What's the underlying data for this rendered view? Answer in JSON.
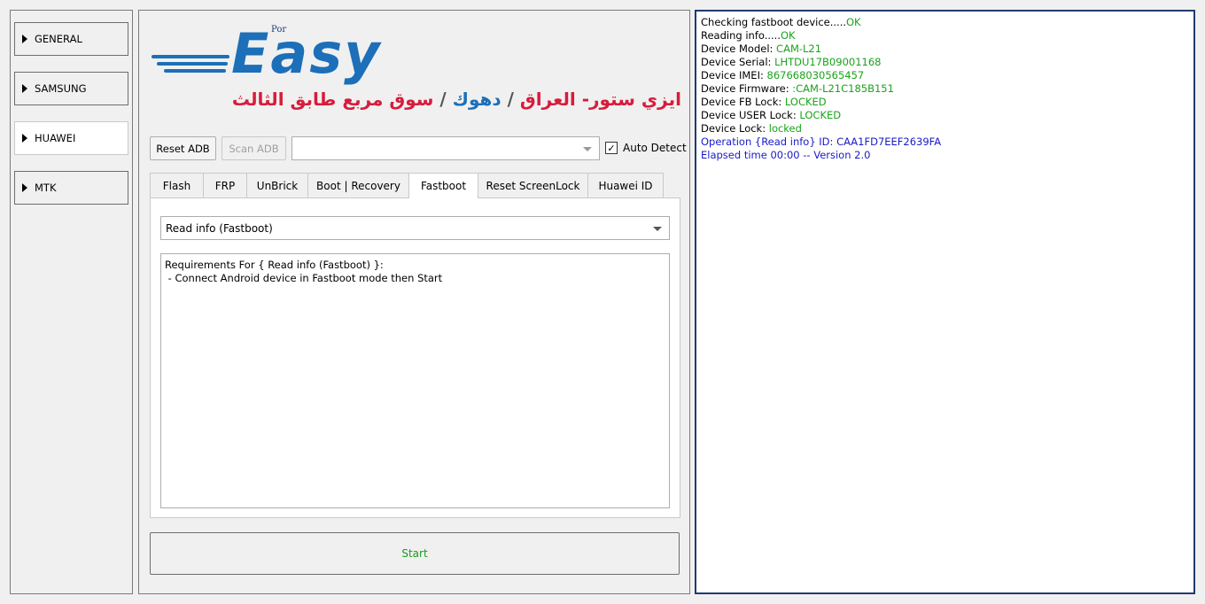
{
  "categories": [
    {
      "label": "GENERAL",
      "active": false
    },
    {
      "label": "SAMSUNG",
      "active": false
    },
    {
      "label": "HUAWEI",
      "active": true
    },
    {
      "label": "MTK",
      "active": false
    }
  ],
  "logo": {
    "small_text": "Por",
    "main_text": "Easy",
    "arabic_part1": "ايزي ستور- العراق",
    "arabic_sep1": "/",
    "arabic_part2": "دهوك",
    "arabic_sep2": "/",
    "arabic_part3": "سوق مربع طابق الثالث"
  },
  "toolbar": {
    "reset_adb": "Reset ADB",
    "scan_adb": "Scan ADB",
    "device_select_value": "",
    "auto_detect_label": "Auto Detect",
    "auto_detect_checked": true
  },
  "tabs": [
    {
      "label": "Flash",
      "active": false
    },
    {
      "label": "FRP",
      "active": false
    },
    {
      "label": "UnBrick",
      "active": false
    },
    {
      "label": "Boot | Recovery",
      "active": false
    },
    {
      "label": "Fastboot",
      "active": true
    },
    {
      "label": "Reset ScreenLock",
      "active": false
    },
    {
      "label": "Huawei ID",
      "active": false
    }
  ],
  "operation": {
    "selected": "Read info (Fastboot)",
    "requirements_line1": "Requirements For { Read info (Fastboot) }:",
    "requirements_line2": " - Connect Android device in Fastboot mode then Start"
  },
  "start_label": "Start",
  "log": {
    "l1_label": "Checking fastboot device.....",
    "l1_value": "OK",
    "l2_label": "Reading info.....",
    "l2_value": "OK",
    "l3_label": "Device Model: ",
    "l3_value": "CAM-L21",
    "l4_label": "Device Serial: ",
    "l4_value": "LHTDU17B09001168",
    "l5_label": "Device IMEI: ",
    "l5_value": "867668030565457",
    "l6_label": "Device Firmware: ",
    "l6_value": ":CAM-L21C185B151",
    "l7_label": "Device FB Lock: ",
    "l7_value": "LOCKED",
    "l8_label": "Device USER Lock: ",
    "l8_value": "LOCKED",
    "l9_label": "Device Lock: ",
    "l9_value": "locked",
    "l10": "Operation {Read info} ID: CAA1FD7EEF2639FA",
    "l11": "Elapsed time 00:00 -- Version 2.0"
  },
  "colors": {
    "ok_green": "#1aa31a",
    "info_blue": "#1a1ac8",
    "logo_blue": "#1c6fb8",
    "logo_red": "#d81b3c"
  }
}
